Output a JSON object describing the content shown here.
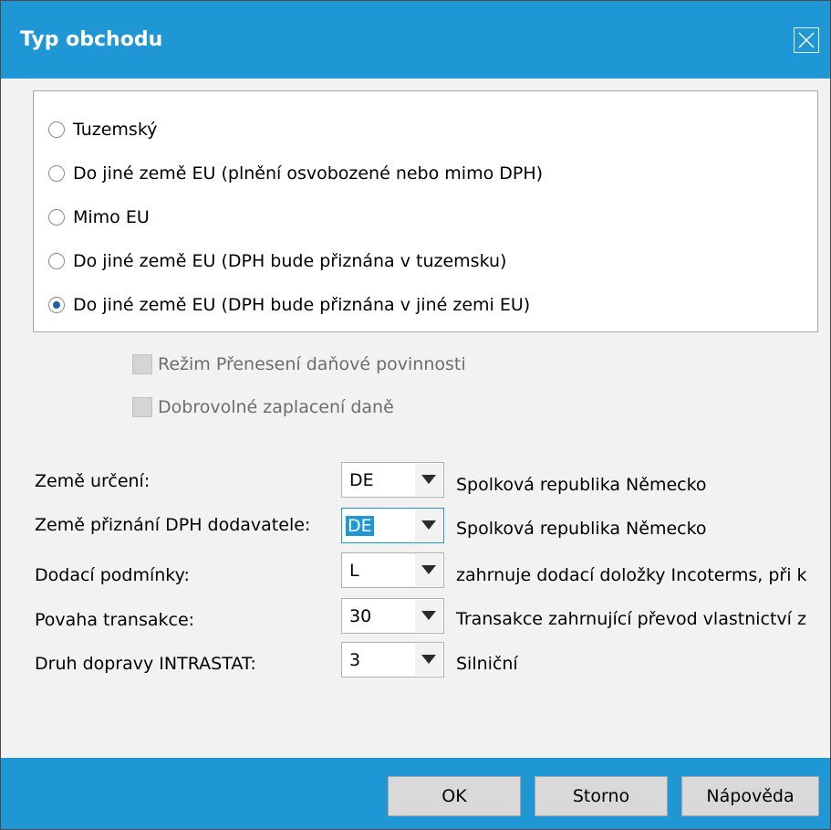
{
  "dialog": {
    "title": "Typ obchodu"
  },
  "trade_type": {
    "options": [
      {
        "label": "Tuzemský",
        "selected": false
      },
      {
        "label": "Do jiné země EU (plnění osvobozené nebo mimo DPH)",
        "selected": false
      },
      {
        "label": "Mimo EU",
        "selected": false
      },
      {
        "label": "Do jiné země EU (DPH bude přiznána v tuzemsku)",
        "selected": false
      },
      {
        "label": "Do jiné země EU (DPH bude přiznána v jiné zemi EU)",
        "selected": true
      }
    ]
  },
  "options": {
    "reverse_charge": {
      "label": "Režim Přenesení daňové povinnosti",
      "checked": false,
      "enabled": false
    },
    "voluntary_tax": {
      "label": "Dobrovolné zaplacení daně",
      "checked": false,
      "enabled": false
    }
  },
  "fields": [
    {
      "label": "Země určení:",
      "value": "DE",
      "description": "Spolková republika Německo"
    },
    {
      "label": "Země přiznání DPH dodavatele:",
      "value": "DE",
      "description": "Spolková republika Německo"
    },
    {
      "label": "Dodací podmínky:",
      "value": "L",
      "description": "zahrnuje dodací doložky Incoterms, při k"
    },
    {
      "label": "Povaha transakce:",
      "value": "30",
      "description": "Transakce zahrnující převod vlastnictví z"
    },
    {
      "label": "Druh dopravy INTRASTAT:",
      "value": "3",
      "description": "Silniční"
    }
  ],
  "buttons": {
    "ok": "OK",
    "cancel": "Storno",
    "help": "Nápověda"
  },
  "colors": {
    "accent": "#1e97d4",
    "window_bg": "#f2f2f2",
    "button_bg": "#d9d9d9"
  }
}
